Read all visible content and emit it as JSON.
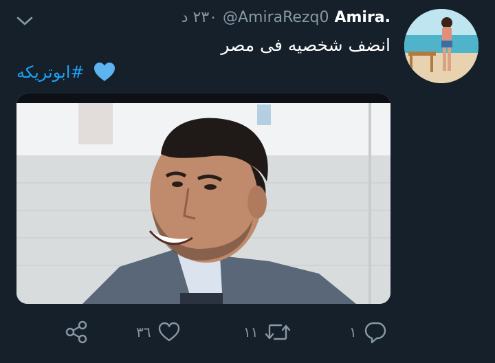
{
  "tweet": {
    "display_name": "Amira.",
    "handle": "@AmiraRezq0",
    "timestamp": "٢٣٠ د",
    "text": "انضف شخصيه فى مصر",
    "hashtag": "#ابوتريكه"
  },
  "actions": {
    "reply_count": "١",
    "retweet_count": "١١",
    "like_count": "٣٦"
  },
  "icons": {
    "menu": "chevron-down-icon",
    "reply": "reply-icon",
    "retweet": "retweet-icon",
    "like": "heart-icon",
    "share": "share-icon",
    "hashtag_emoji": "blue-heart-icon"
  },
  "colors": {
    "background": "#15202b",
    "secondary_text": "#8899a6",
    "link": "#1da1f2"
  }
}
